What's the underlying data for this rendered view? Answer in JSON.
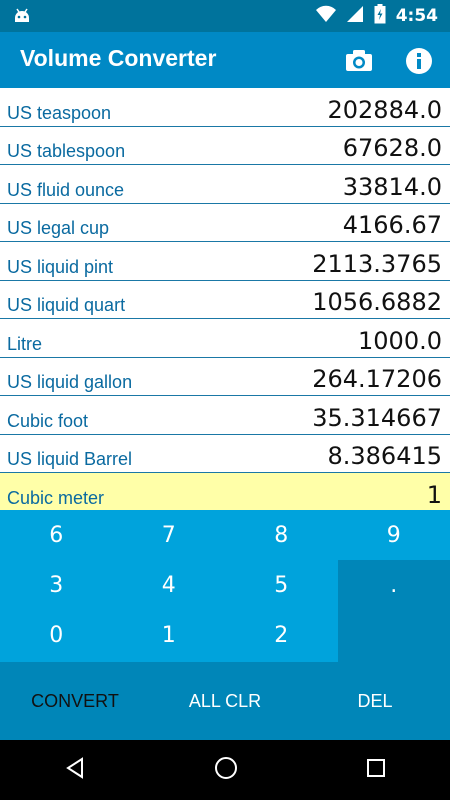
{
  "status_bar": {
    "time": "4:54",
    "icons": [
      "android-icon",
      "wifi-icon",
      "signal-icon",
      "battery-icon"
    ]
  },
  "app_bar": {
    "title": "Volume Converter",
    "actions": [
      "camera-icon",
      "info-icon"
    ]
  },
  "units": [
    {
      "label": "US teaspoon",
      "value": "202884.0"
    },
    {
      "label": "US tablespoon",
      "value": "67628.0"
    },
    {
      "label": "US fluid ounce",
      "value": "33814.0"
    },
    {
      "label": "US legal cup",
      "value": "4166.67"
    },
    {
      "label": "US liquid pint",
      "value": "2113.3765"
    },
    {
      "label": "US liquid quart",
      "value": "1056.6882"
    },
    {
      "label": "Litre",
      "value": "1000.0"
    },
    {
      "label": "US liquid gallon",
      "value": "264.17206"
    },
    {
      "label": "Cubic foot",
      "value": "35.314667"
    },
    {
      "label": "US liquid Barrel",
      "value": "8.386415"
    },
    {
      "label": "Cubic meter",
      "value": "1"
    }
  ],
  "keypad": {
    "keys": [
      "6",
      "7",
      "8",
      "9",
      "3",
      "4",
      "5",
      ".",
      "0",
      "1",
      "2"
    ]
  },
  "actions": {
    "convert": "CONVERT",
    "all_clear": "ALL CLR",
    "delete": "DEL"
  },
  "colors": {
    "status_bar": "#00739c",
    "app_bar": "#0089c5",
    "keypad": "#00a3dc",
    "keypad_dark": "#0086b8",
    "active_row": "#ffffa8",
    "label_text": "#0a6aa0"
  }
}
